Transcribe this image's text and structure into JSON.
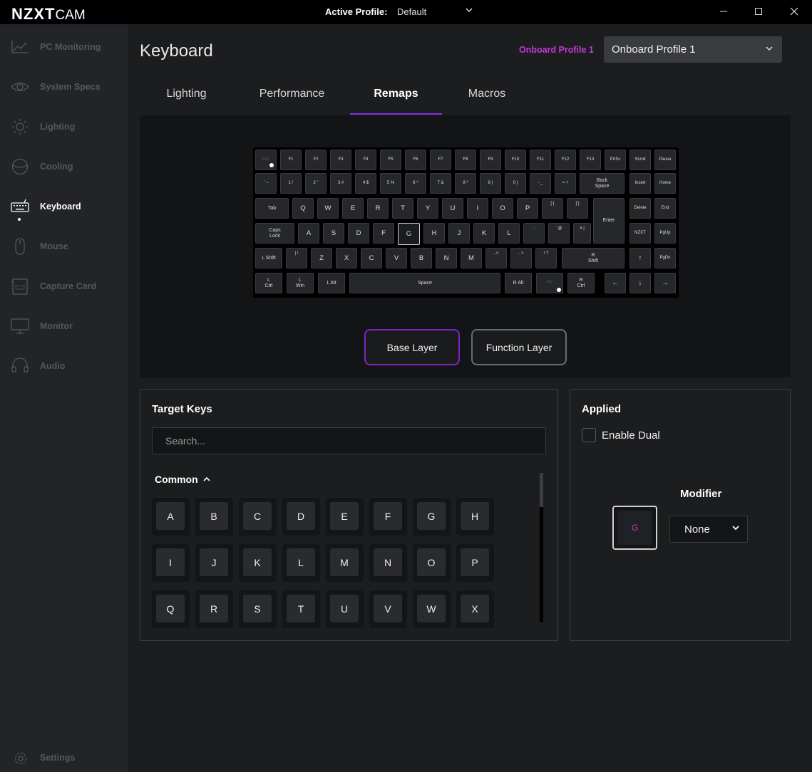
{
  "app": {
    "logo_main": "NZXT",
    "logo_sub": "CAM",
    "active_profile_label": "Active Profile:",
    "active_profile_value": "Default",
    "window_controls": [
      "minimize-icon",
      "maximize-icon",
      "close-icon"
    ]
  },
  "sidebar": {
    "items": [
      {
        "label": "PC Monitoring",
        "icon": "chart-line-icon",
        "active": false
      },
      {
        "label": "System Specs",
        "icon": "eye-icon",
        "active": false
      },
      {
        "label": "Lighting",
        "icon": "sun-icon",
        "active": false
      },
      {
        "label": "Cooling",
        "icon": "fan-icon",
        "active": false
      },
      {
        "label": "Keyboard",
        "icon": "keyboard-icon",
        "active": true
      },
      {
        "label": "Mouse",
        "icon": "mouse-icon",
        "active": false
      },
      {
        "label": "Capture Card",
        "icon": "capture-card-icon",
        "active": false
      },
      {
        "label": "Monitor",
        "icon": "monitor-icon",
        "active": false
      },
      {
        "label": "Audio",
        "icon": "headset-icon",
        "active": false
      }
    ],
    "settings_label": "Settings"
  },
  "main": {
    "title": "Keyboard",
    "onboard_label": "Onboard Profile 1",
    "onboard_select": "Onboard Profile 1",
    "tabs": [
      "Lighting",
      "Performance",
      "Remaps",
      "Macros"
    ],
    "active_tab": "Remaps",
    "selected_key": "G",
    "layers": {
      "base": "Base Layer",
      "function": "Function Layer"
    }
  },
  "keyboard": {
    "rows": [
      [
        "Esc",
        "F1",
        "F2",
        "F3",
        "F4",
        "F5",
        "F6",
        "F7",
        "F8",
        "F9",
        "F10",
        "F11",
        "F12",
        "F13",
        "PrtSc",
        "Scroll",
        "Pause"
      ],
      [
        "` ~",
        "1 !",
        "2 \"",
        "3 #",
        "4 $",
        "5 %",
        "6 ^",
        "7 &",
        "8 *",
        "9 (",
        "0 )",
        "- _",
        "= +",
        "Back Space",
        "Insert",
        "Home"
      ],
      [
        "Tab",
        "Q",
        "W",
        "E",
        "R",
        "T",
        "Y",
        "U",
        "I",
        "O",
        "P",
        "[ {",
        "] }",
        "Enter",
        "Delete",
        "End"
      ],
      [
        "Caps Lock",
        "A",
        "S",
        "D",
        "F",
        "G",
        "H",
        "J",
        "K",
        "L",
        "; :",
        "' @",
        "# |",
        "NZXT",
        "PgUp"
      ],
      [
        "L Shift",
        "| \\",
        "Z",
        "X",
        "C",
        "V",
        "B",
        "N",
        "M",
        ", <",
        ". >",
        "/ ?",
        "R Shift",
        "↑",
        "PgDn"
      ],
      [
        "L Ctrl",
        "L Win",
        "L Alt",
        "Space",
        "R Alt",
        "Fn",
        "R Ctrl",
        "←",
        "↓",
        "→"
      ]
    ]
  },
  "target_keys": {
    "title": "Target Keys",
    "search_placeholder": "Search...",
    "section": "Common",
    "keys": [
      "A",
      "B",
      "C",
      "D",
      "E",
      "F",
      "G",
      "H",
      "I",
      "J",
      "K",
      "L",
      "M",
      "N",
      "O",
      "P",
      "Q",
      "R",
      "S",
      "T",
      "U",
      "V",
      "W",
      "X"
    ]
  },
  "applied": {
    "title": "Applied",
    "enable_dual": "Enable Dual",
    "enable_dual_checked": false,
    "modifier_label": "Modifier",
    "applied_key": "G",
    "modifier_value": "None"
  },
  "colors": {
    "accent": "#8a2be2",
    "magenta": "#c63ad7"
  }
}
